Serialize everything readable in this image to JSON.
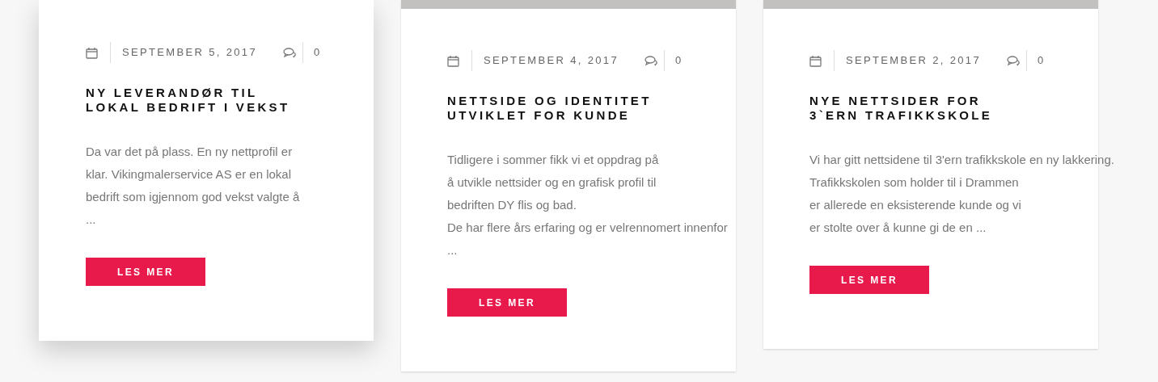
{
  "posts": [
    {
      "hovered": true,
      "date": "SEPTEMBER 5, 2017",
      "comments": "0",
      "title": [
        "NY LEVERANDØR TIL",
        "LOKAL BEDRIFT I VEKST"
      ],
      "excerpt": [
        "Da var det på plass. En ny nettprofil er",
        "klar. Vikingmalerservice AS er en lokal",
        "bedrift som igjennom god vekst valgte å",
        "..."
      ],
      "button": "LES MER"
    },
    {
      "hovered": false,
      "date": "SEPTEMBER 4, 2017",
      "comments": "0",
      "title": [
        "NETTSIDE OG IDENTITET",
        "UTVIKLET FOR KUNDE"
      ],
      "excerpt": [
        "Tidligere i sommer fikk vi et oppdrag på",
        "å utvikle nettsider og en grafisk profil til",
        "bedriften DY flis og bad.",
        "De har flere års erfaring og er velrennomert innenfor",
        "..."
      ],
      "button": "LES MER"
    },
    {
      "hovered": false,
      "date": "SEPTEMBER 2, 2017",
      "comments": "0",
      "title": [
        "NYE NETTSIDER FOR",
        "3`ERN TRAFIKKSKOLE"
      ],
      "excerpt": [
        "Vi har gitt nettsidene til 3'ern trafikkskole en ny lakkering.",
        "Trafikkskolen som holder til i Drammen",
        "er allerede en eksisterende kunde og vi",
        "er stolte over å kunne gi de en ..."
      ],
      "button": "LES MER"
    }
  ]
}
